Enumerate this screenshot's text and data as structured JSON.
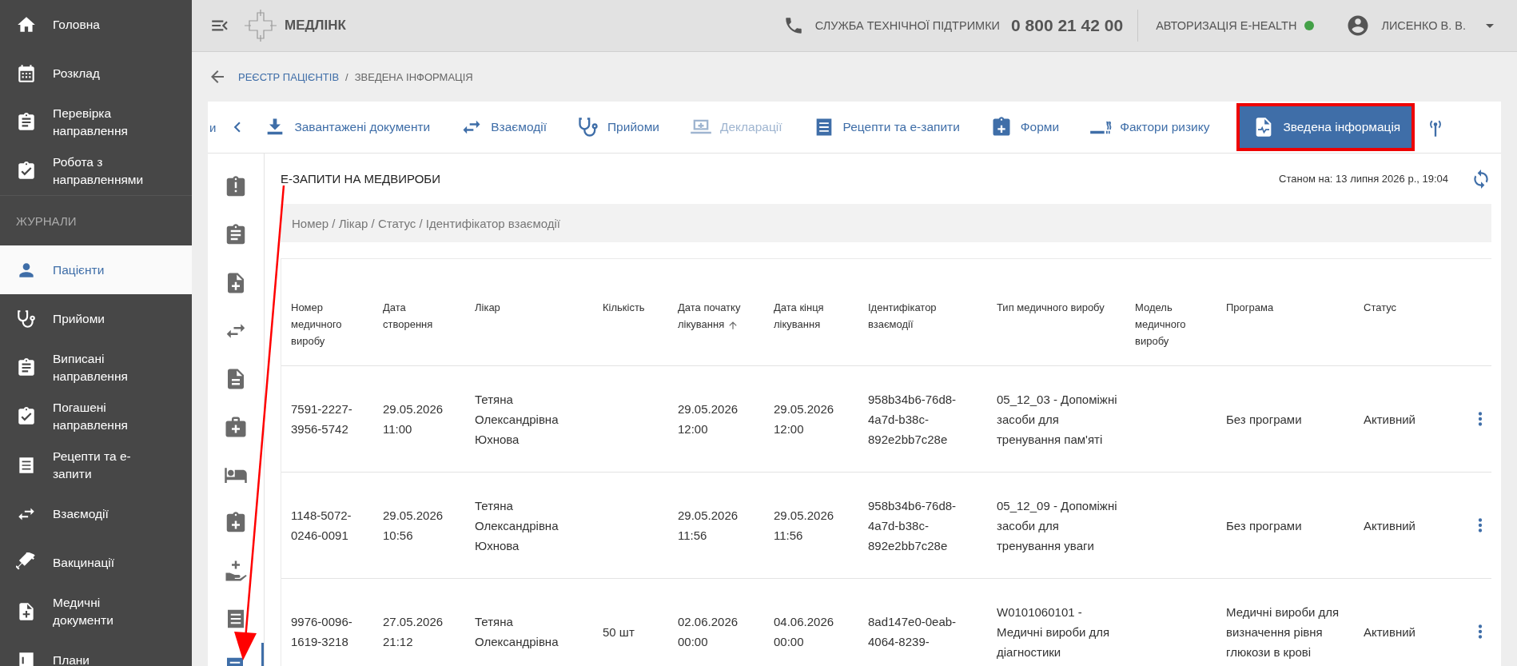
{
  "sidebar": {
    "items": [
      {
        "kind": "link",
        "label": "Головна",
        "selected": false
      },
      {
        "kind": "link",
        "label": "Розклад",
        "selected": false
      },
      {
        "kind": "link",
        "label": "Перевірка направлення",
        "selected": false
      },
      {
        "kind": "link",
        "label": "Робота з направленнями",
        "selected": false
      },
      {
        "kind": "section",
        "label": "ЖУРНАЛИ"
      },
      {
        "kind": "link",
        "label": "Пацієнти",
        "selected": true
      },
      {
        "kind": "link",
        "label": "Прийоми",
        "selected": false
      },
      {
        "kind": "link",
        "label": "Виписані направлення",
        "selected": false
      },
      {
        "kind": "link",
        "label": "Погашені направлення",
        "selected": false
      },
      {
        "kind": "link",
        "label": "Рецепти та е-запити",
        "selected": false
      },
      {
        "kind": "link",
        "label": "Взаємодії",
        "selected": false
      },
      {
        "kind": "link",
        "label": "Вакцинації",
        "selected": false
      },
      {
        "kind": "link",
        "label": "Медичні документи",
        "selected": false
      },
      {
        "kind": "link",
        "label": "Плани",
        "selected": false
      }
    ]
  },
  "header": {
    "logo": "МЕДЛІНК",
    "support_label": "СЛУЖБА ТЕХНІЧНОЇ ПІДТРИМКИ",
    "support_phone": "0 800 21 42 00",
    "ehealth": {
      "label": "АВТОРИЗАЦІЯ E-HEALTH",
      "connected": true
    },
    "user": "ЛИСЕНКО В. В."
  },
  "breadcrumb": {
    "parent": "РЕЄСТР ПАЦІЄНТІВ",
    "separator": "/",
    "current": "ЗВЕДЕНА ІНФОРМАЦІЯ"
  },
  "tabs": {
    "cut_label": "и",
    "items": [
      {
        "label": "Завантажені документи",
        "selected": false,
        "disabled": false,
        "highlighted": false
      },
      {
        "label": "Взаємодії",
        "selected": false,
        "disabled": false,
        "highlighted": false
      },
      {
        "label": "Прийоми",
        "selected": false,
        "disabled": false,
        "highlighted": false
      },
      {
        "label": "Декларації",
        "selected": false,
        "disabled": true,
        "highlighted": false
      },
      {
        "label": "Рецепти та е-запити",
        "selected": false,
        "disabled": false,
        "highlighted": false
      },
      {
        "label": "Форми",
        "selected": false,
        "disabled": false,
        "highlighted": false
      },
      {
        "label": "Фактори ризику",
        "selected": false,
        "disabled": false,
        "highlighted": false
      },
      {
        "label": "Зведена інформація",
        "selected": true,
        "disabled": false,
        "highlighted": true
      }
    ]
  },
  "side_tools": [
    {
      "selected": false
    },
    {
      "selected": false
    },
    {
      "selected": false
    },
    {
      "selected": false
    },
    {
      "selected": false
    },
    {
      "selected": false
    },
    {
      "selected": false
    },
    {
      "selected": false
    },
    {
      "selected": false
    },
    {
      "selected": false
    },
    {
      "selected": true
    }
  ],
  "section": {
    "title": "Е-ЗАПИТИ НА МЕДВИРОБИ",
    "as_of": "Станом на: 13 липня 2026 р., 19:04"
  },
  "search": {
    "placeholder": "Номер / Лікар / Статус / Ідентифікатор взаємодії"
  },
  "table": {
    "columns": [
      {
        "label": "Номер медичного виробу",
        "sorted": false
      },
      {
        "label": "Дата створення",
        "sorted": false
      },
      {
        "label": "Лікар",
        "sorted": false
      },
      {
        "label": "Кількість",
        "sorted": false
      },
      {
        "label": "Дата початку лікування",
        "sorted": true
      },
      {
        "label": "Дата кінця лікування",
        "sorted": false
      },
      {
        "label": "Ідентифікатор взаємодії",
        "sorted": false
      },
      {
        "label": "Тип медичного виробу",
        "sorted": false
      },
      {
        "label": "Модель медичного виробу",
        "sorted": false
      },
      {
        "label": "Програма",
        "sorted": false
      },
      {
        "label": "Статус",
        "sorted": false
      }
    ],
    "rows": [
      {
        "cells": [
          "7591-2227-3956-5742",
          "29.05.2026 11:00",
          "Тетяна Олександрівна Юхнова",
          "",
          "29.05.2026 12:00",
          "29.05.2026 12:00",
          "958b34b6-76d8-4a7d-b38c-892e2bb7c28e",
          "05_12_03 - Допоміжні засоби для тренування пам'яті",
          "",
          "Без програми",
          "Активний"
        ]
      },
      {
        "cells": [
          "1148-5072-0246-0091",
          "29.05.2026 10:56",
          "Тетяна Олександрівна Юхнова",
          "",
          "29.05.2026 11:56",
          "29.05.2026 11:56",
          "958b34b6-76d8-4a7d-b38c-892e2bb7c28e",
          "05_12_09 - Допоміжні засоби для тренування уваги",
          "",
          "Без програми",
          "Активний"
        ]
      },
      {
        "cells": [
          "9976-0096-1619-3218",
          "27.05.2026 21:12",
          "Тетяна Олександрівна",
          "50 шт",
          "02.06.2026 00:00",
          "04.06.2026 00:00",
          "8ad147e0-0eab-4064-8239-",
          "W0101060101 - Медичні вироби для діагностики",
          "",
          "Медичні вироби для визначення рівня глюкози в крові",
          "Активний"
        ]
      }
    ]
  }
}
